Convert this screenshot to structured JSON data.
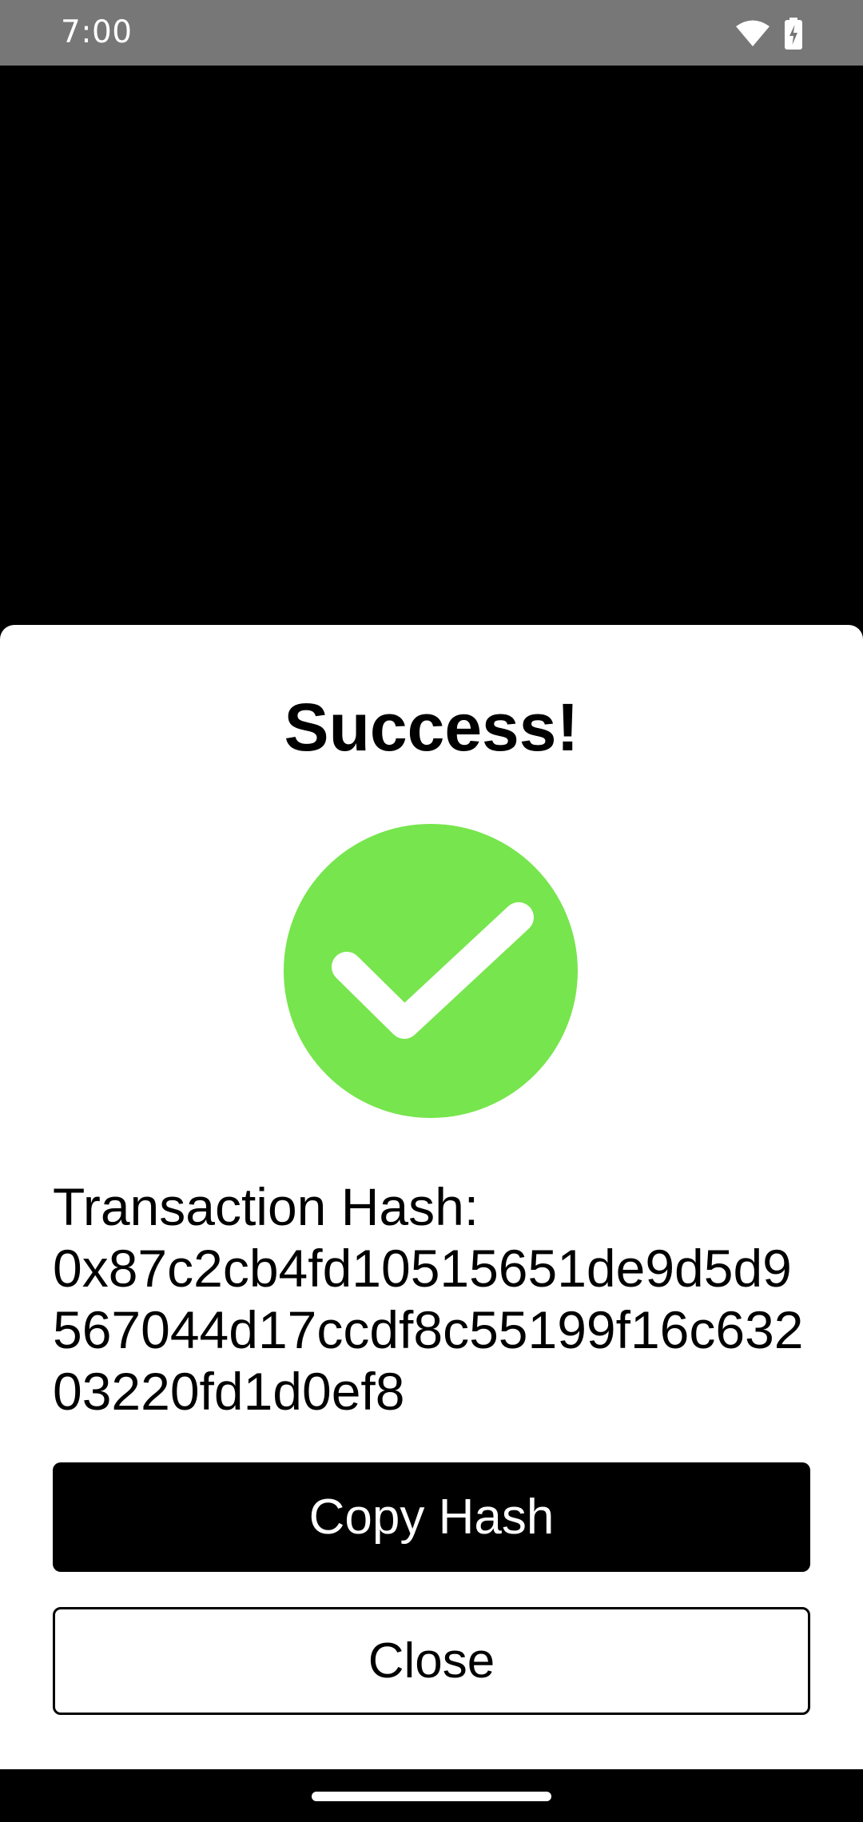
{
  "status_bar": {
    "time": "7:00",
    "wifi_icon": "wifi-icon",
    "battery_icon": "battery-charging-icon"
  },
  "dialog": {
    "title": "Success!",
    "icon": "check-circle-icon",
    "icon_color": "#77E54D",
    "hash_label": "Transaction Hash:",
    "hash_value": "0x87c2cb4fd10515651de9d5d9567044d17ccdf8c55199f16c63203220fd1d0ef8",
    "copy_button_label": "Copy Hash",
    "close_button_label": "Close"
  },
  "colors": {
    "status_bar_bg": "#777777",
    "backdrop": "#000000",
    "sheet_bg": "#FFFFFF",
    "primary_button_bg": "#000000"
  }
}
